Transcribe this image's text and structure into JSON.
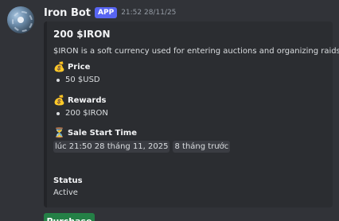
{
  "message": {
    "username": "Iron Bot",
    "badge": "APP",
    "timestamp": "21:52 28/11/25"
  },
  "embed": {
    "title": "200 $IRON",
    "description": "$IRON is a soft currency used for entering auctions and organizing raids.",
    "price": {
      "icon": "money-bag-icon",
      "label": "Price",
      "items": [
        "50 $USD"
      ]
    },
    "rewards": {
      "icon": "money-bag-icon",
      "label": "Rewards",
      "items": [
        "200 $IRON"
      ]
    },
    "sale_start": {
      "icon": "hourglass-icon",
      "label": "Sale Start Time",
      "time": "lúc 21:50 28 tháng 11, 2025",
      "relative": "8 tháng trước"
    },
    "status": {
      "label": "Status",
      "value": "Active"
    }
  },
  "actions": {
    "buy_label": "Purchase"
  },
  "colors": {
    "background": "#313338",
    "embed_background": "#2b2d31",
    "app_badge": "#5865f2",
    "button": "#248046"
  }
}
